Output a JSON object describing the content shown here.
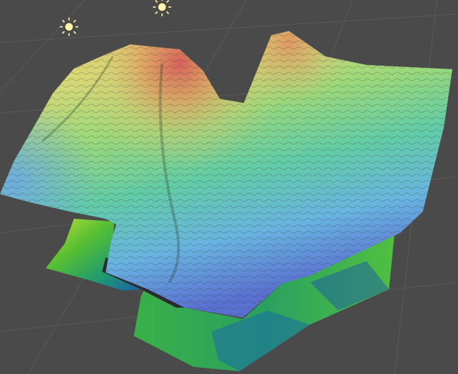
{
  "viewport": {
    "background_color": "#4a4a4a",
    "grid_color": "#5a5a5a"
  },
  "icons": {
    "light_1": "sun-icon",
    "light_2": "sun-icon"
  },
  "terrain": {
    "colormap": [
      "#d9605a",
      "#e3a060",
      "#e8d878",
      "#9ad878",
      "#5cc8a8",
      "#6ab0e0",
      "#5a6ad0"
    ],
    "skirt_colormap": [
      "#d8e040",
      "#60c030",
      "#20a060",
      "#1a6aa0"
    ],
    "shadow_color": "#2c2c30"
  }
}
